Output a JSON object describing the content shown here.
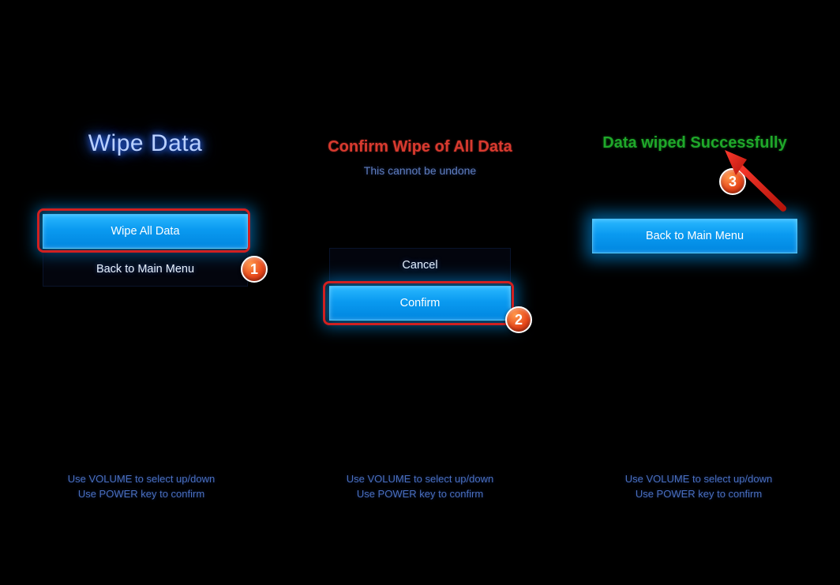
{
  "panel1": {
    "title": "Wipe Data",
    "wipe_all_label": "Wipe All Data",
    "back_label": "Back to Main Menu",
    "footer1": "Use VOLUME to select up/down",
    "footer2": "Use POWER key to confirm",
    "badge": "1"
  },
  "panel2": {
    "title": "Confirm Wipe of All Data",
    "subtitle": "This cannot be undone",
    "cancel_label": "Cancel",
    "confirm_label": "Confirm",
    "footer1": "Use VOLUME to select up/down",
    "footer2": "Use POWER key to confirm",
    "badge": "2"
  },
  "panel3": {
    "title": "Data wiped Successfully",
    "back_label": "Back to Main Menu",
    "footer1": "Use VOLUME to select up/down",
    "footer2": "Use POWER key to confirm",
    "badge": "3"
  }
}
